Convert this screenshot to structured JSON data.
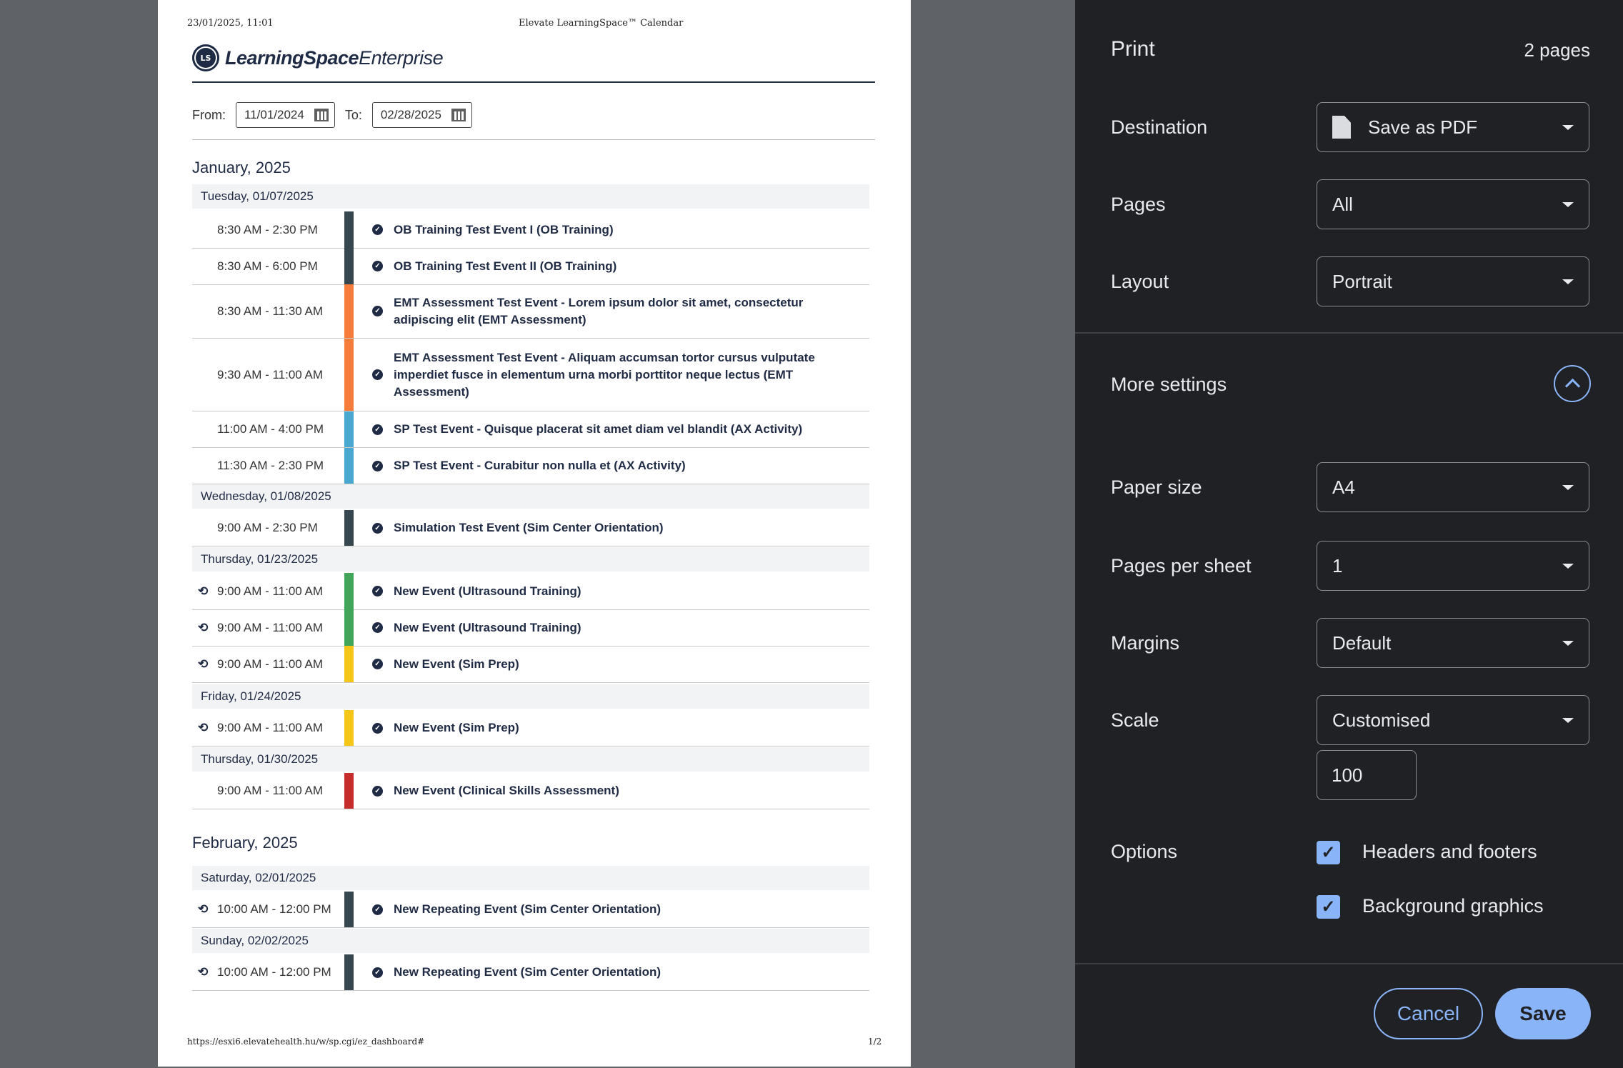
{
  "page": {
    "header_date": "23/01/2025, 11:01",
    "header_title": "Elevate LearningSpace™ Calendar",
    "logo_mark": "LS",
    "logo_bold": "LearningSpace",
    "logo_light": "Enterprise",
    "from_label": "From:",
    "from_value": "11/01/2024",
    "to_label": "To:",
    "to_value": "02/28/2025",
    "footer_url": "https://esxi6.elevatehealth.hu/w/sp.cgi/ez_dashboard#",
    "footer_page": "1/2",
    "months": [
      {
        "name": "January, 2025",
        "days": [
          {
            "label": "Tuesday, 01/07/2025",
            "events": [
              {
                "time": "8:30 AM - 2:30 PM",
                "title": "OB Training Test Event I (OB Training)",
                "color": "#37474f",
                "repeat": false
              },
              {
                "time": "8:30 AM - 6:00 PM",
                "title": "OB Training Test Event II (OB Training)",
                "color": "#37474f",
                "repeat": false
              },
              {
                "time": "8:30 AM - 11:30 AM",
                "title": "EMT Assessment Test Event - Lorem ipsum dolor sit amet, consectetur adipiscing elit (EMT Assessment)",
                "color": "#f57c3a",
                "repeat": false
              },
              {
                "time": "9:30 AM - 11:00 AM",
                "title": "EMT Assessment Test Event - Aliquam accumsan tortor cursus vulputate imperdiet fusce in elementum urna morbi porttitor neque lectus (EMT Assessment)",
                "color": "#f57c3a",
                "repeat": false
              },
              {
                "time": "11:00 AM - 4:00 PM",
                "title": "SP Test Event - Quisque placerat sit amet diam vel blandit (AX Activity)",
                "color": "#4aa8d0",
                "repeat": false
              },
              {
                "time": "11:30 AM - 2:30 PM",
                "title": "SP Test Event - Curabitur non nulla et (AX Activity)",
                "color": "#4aa8d0",
                "repeat": false
              }
            ]
          },
          {
            "label": "Wednesday, 01/08/2025",
            "events": [
              {
                "time": "9:00 AM - 2:30 PM",
                "title": "Simulation Test Event (Sim Center Orientation)",
                "color": "#37474f",
                "repeat": false
              }
            ]
          },
          {
            "label": "Thursday, 01/23/2025",
            "events": [
              {
                "time": "9:00 AM - 11:00 AM",
                "title": "New Event (Ultrasound Training)",
                "color": "#43a55a",
                "repeat": true
              },
              {
                "time": "9:00 AM - 11:00 AM",
                "title": "New Event (Ultrasound Training)",
                "color": "#43a55a",
                "repeat": true
              },
              {
                "time": "9:00 AM - 11:00 AM",
                "title": "New Event (Sim Prep)",
                "color": "#f5c518",
                "repeat": true
              }
            ]
          },
          {
            "label": "Friday, 01/24/2025",
            "events": [
              {
                "time": "9:00 AM - 11:00 AM",
                "title": "New Event (Sim Prep)",
                "color": "#f5c518",
                "repeat": true
              }
            ]
          },
          {
            "label": "Thursday, 01/30/2025",
            "events": [
              {
                "time": "9:00 AM - 11:00 AM",
                "title": "New Event (Clinical Skills Assessment)",
                "color": "#c62e2e",
                "repeat": false
              }
            ]
          }
        ]
      },
      {
        "name": "February, 2025",
        "days": [
          {
            "label": "Saturday, 02/01/2025",
            "events": [
              {
                "time": "10:00 AM - 12:00 PM",
                "title": "New Repeating Event (Sim Center Orientation)",
                "color": "#37474f",
                "repeat": true
              }
            ]
          },
          {
            "label": "Sunday, 02/02/2025",
            "events": [
              {
                "time": "10:00 AM - 12:00 PM",
                "title": "New Repeating Event (Sim Center Orientation)",
                "color": "#37474f",
                "repeat": true
              }
            ]
          }
        ]
      }
    ]
  },
  "print": {
    "title": "Print",
    "page_count": "2 pages",
    "destination_label": "Destination",
    "destination_value": "Save as PDF",
    "pages_label": "Pages",
    "pages_value": "All",
    "layout_label": "Layout",
    "layout_value": "Portrait",
    "more_settings_label": "More settings",
    "paper_size_label": "Paper size",
    "paper_size_value": "A4",
    "pages_per_sheet_label": "Pages per sheet",
    "pages_per_sheet_value": "1",
    "margins_label": "Margins",
    "margins_value": "Default",
    "scale_label": "Scale",
    "scale_value": "Customised",
    "scale_number": "100",
    "options_label": "Options",
    "headers_footers_label": "Headers and footers",
    "headers_footers_checked": true,
    "background_graphics_label": "Background graphics",
    "background_graphics_checked": true,
    "cancel_label": "Cancel",
    "save_label": "Save",
    "accent_color": "#8ab4f8"
  }
}
